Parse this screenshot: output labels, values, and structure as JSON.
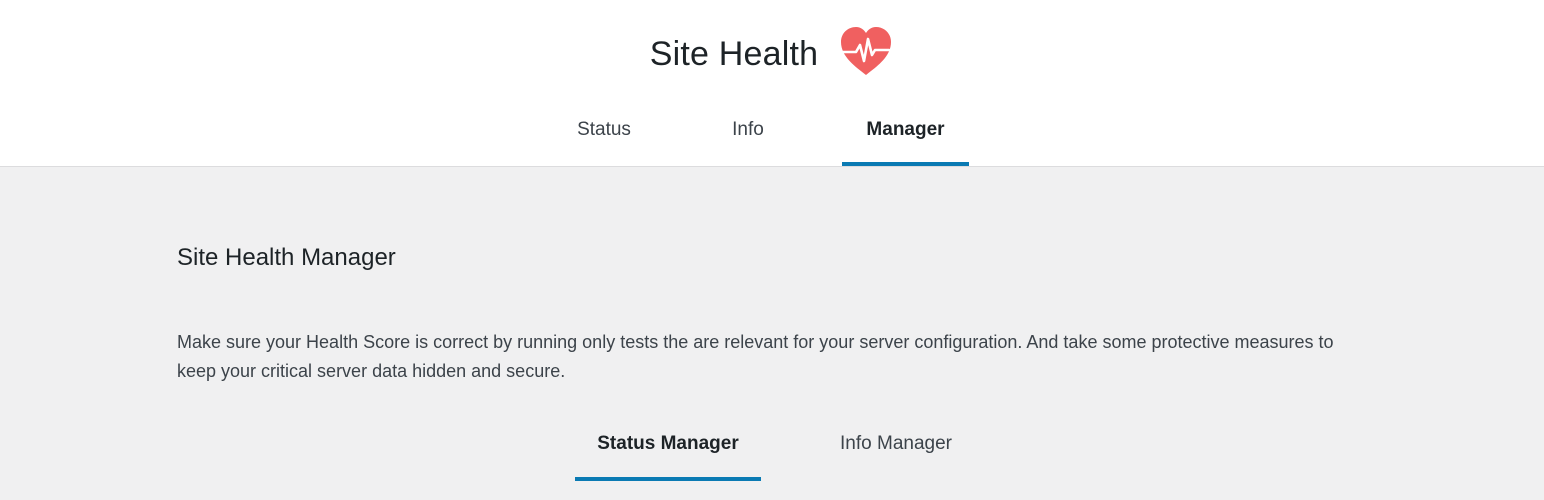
{
  "header": {
    "title": "Site Health",
    "title_icon": "heart-pulse-icon",
    "tabs": [
      {
        "label": "Status",
        "active": false
      },
      {
        "label": "Info",
        "active": false
      },
      {
        "label": "Manager",
        "active": true
      }
    ]
  },
  "main": {
    "section_title": "Site Health Manager",
    "description": "Make sure your Health Score is correct by running only tests the are relevant for your server configuration. And take some protective measures to keep your critical server data hidden and secure.",
    "subtabs": [
      {
        "label": "Status Manager",
        "active": true
      },
      {
        "label": "Info Manager",
        "active": false
      }
    ]
  },
  "colors": {
    "accent": "#0a7ab3",
    "heart": "#f06060",
    "header_bg": "#ffffff",
    "page_bg": "#f0f0f1"
  }
}
